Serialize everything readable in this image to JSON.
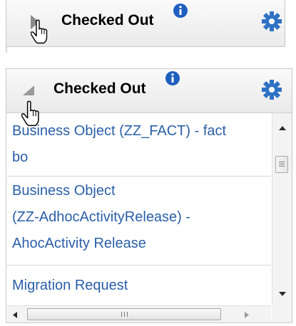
{
  "collapsed_panel": {
    "title": "Checked Out",
    "toggle_state": "collapsed"
  },
  "expanded_panel": {
    "title": "Checked Out",
    "toggle_state": "expanded",
    "items": [
      {
        "lines": [
          "Business Object (ZZ_FACT) - fact",
          "bo"
        ]
      },
      {
        "lines": [
          "Business Object",
          "(ZZ-AdhocActivityRelease) -",
          "AhocActivity Release"
        ]
      },
      {
        "lines": [
          "Migration Request"
        ]
      }
    ],
    "hscroll_thumb_grip": "III"
  },
  "colors": {
    "link": "#2a5fa8",
    "info_blue": "#1f5fbf",
    "gear_blue": "#2f72c4"
  },
  "icons": {
    "info": "info-icon",
    "settings": "gear-icon",
    "collapsed_toggle": "triangle-right-icon",
    "expanded_toggle": "triangle-down-icon",
    "cursor": "hand-pointer-icon"
  }
}
